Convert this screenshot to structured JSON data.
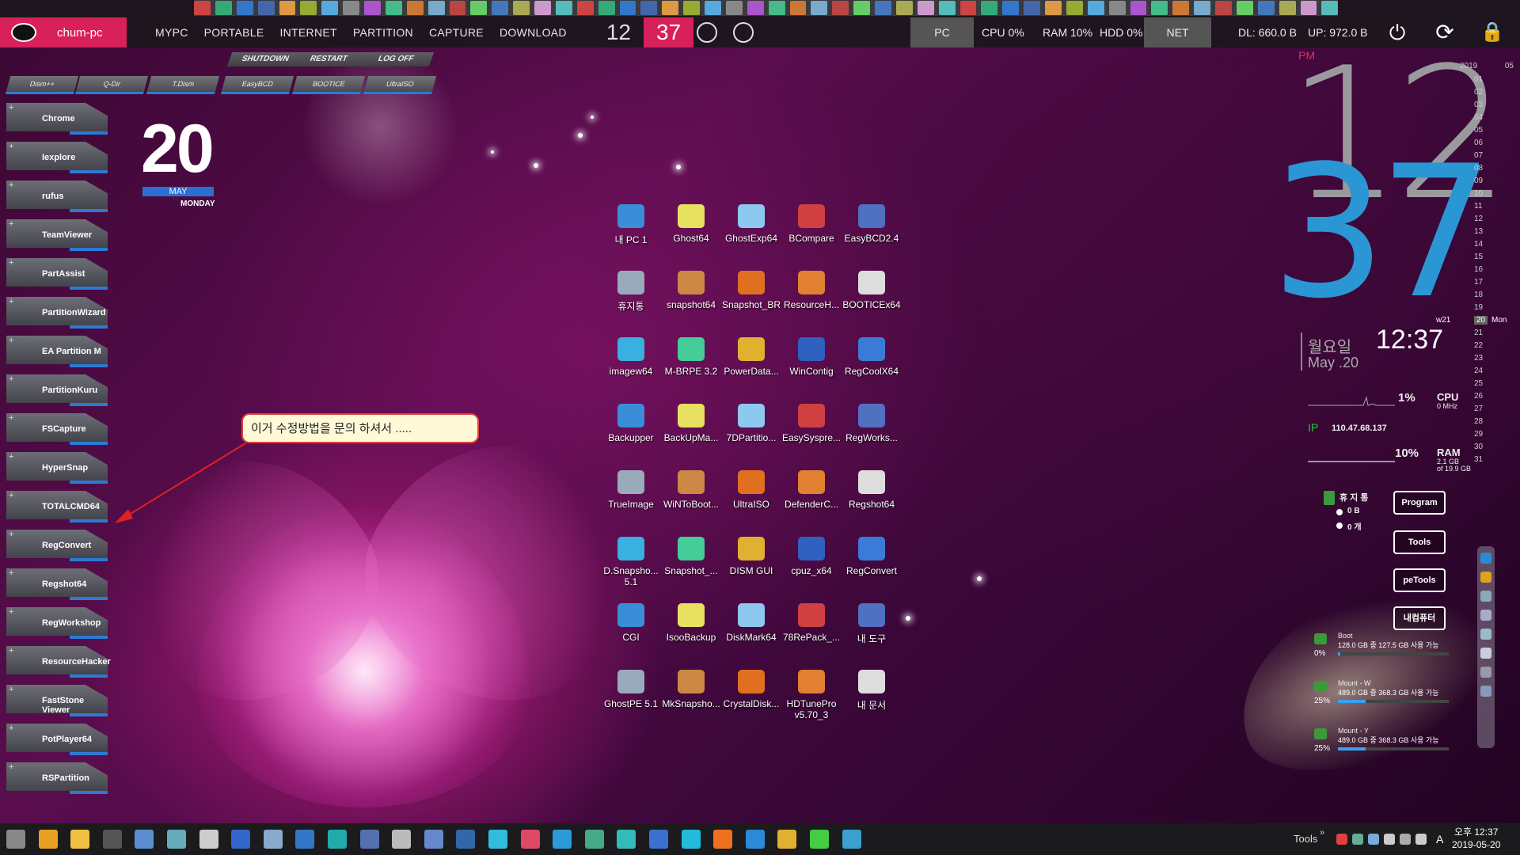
{
  "topbar": {
    "user": "chum-pc",
    "menu": [
      "MYPC",
      "PORTABLE",
      "INTERNET",
      "PARTITION",
      "CAPTURE",
      "DOWNLOAD"
    ],
    "hour": "12",
    "minute": "37",
    "pc_label": "PC",
    "cpu": "CPU  0%",
    "ram": "RAM  10%",
    "hdd": "HDD  0%",
    "net_label": "NET",
    "dl": "DL: 660.0 B",
    "up": "UP: 972.0 B"
  },
  "power": [
    "SHUTDOWN",
    "RESTART",
    "LOG  OFF"
  ],
  "quick_tools": [
    "Dism++",
    "Q-Dir",
    "T.Dism",
    "EasyBCD",
    "BOOTICE",
    "UltraISO"
  ],
  "launchers": [
    "Chrome",
    "Iexplore",
    "rufus",
    "TeamViewer",
    "PartAssist",
    "PartitionWizard",
    "EA  Partition  M",
    "PartitionKuru",
    "FSCapture",
    "HyperSnap",
    "TOTALCMD64",
    "RegConvert",
    "Regshot64",
    "RegWorkshop",
    "ResourceHacker",
    "FastStone  Viewer",
    "PotPlayer64",
    "RSPartition"
  ],
  "date": {
    "day": "20",
    "month": "MAY",
    "weekday": "MONDAY"
  },
  "callout": "이거 수정방법을 문의 하셔서 .....",
  "desktop_icons": [
    [
      "내 PC 1",
      "Ghost64",
      "GhostExp64",
      "BCompare",
      "EasyBCD2.4"
    ],
    [
      "휴지통",
      "snapshot64",
      "Snapshot_BR",
      "ResourceH...",
      "BOOTICEx64"
    ],
    [
      "imagew64",
      "M-BRPE 3.2",
      "PowerData...",
      "WinContig",
      "RegCoolX64"
    ],
    [
      "Backupper",
      "BackUpMa...",
      "7DPartitio...",
      "EasySyspre...",
      "RegWorks..."
    ],
    [
      "TrueImage",
      "WiNToBoot...",
      "UltraISO",
      "DefenderC...",
      "Regshot64"
    ],
    [
      "D.Snapsho... 5.1",
      "Snapshot_...",
      "DISM GUI",
      "cpuz_x64",
      "RegConvert"
    ],
    [
      "CGI",
      "IsooBackup",
      "DiskMark64",
      "78RePack_...",
      "내 도구"
    ],
    [
      "GhostPE 5.1",
      "MkSnapsho...",
      "CrystalDisk...",
      "HDTunePro v5.70_3",
      "내 문서"
    ]
  ],
  "clock": {
    "ampm": "PM",
    "hour": "12",
    "minute": "37",
    "time": "12:37",
    "day_kr": "월요일",
    "day_en": "May .20"
  },
  "meters": {
    "cpu_pct": "1%",
    "cpu_label": "CPU",
    "cpu_mhz": "0 MHz",
    "ip_label": "IP",
    "ip": "110.47.68.137",
    "ram_pct": "10%",
    "ram_label": "RAM",
    "ram_detail": "2.1 GB",
    "ram_total": "of 19.9 GB"
  },
  "calendar": {
    "year": "2019",
    "month": "05",
    "week": "w21",
    "today": "20",
    "today_name": "Mon",
    "days": [
      "01",
      "02",
      "03",
      "04",
      "05",
      "06",
      "07",
      "08",
      "09",
      "10",
      "11",
      "12",
      "13",
      "14",
      "15",
      "16",
      "17",
      "18",
      "19",
      "20",
      "21",
      "22",
      "23",
      "24",
      "25",
      "26",
      "27",
      "28",
      "29",
      "30",
      "31"
    ]
  },
  "recycle": {
    "label": "휴 지 통",
    "size": "0 B",
    "count": "0 개"
  },
  "side_buttons": [
    "Program",
    "Tools",
    "peTools",
    "내컴퓨터"
  ],
  "drives": [
    {
      "name": "Boot",
      "detail": "128.0 GB 중 127.5 GB 사용 가능",
      "pct": "0%",
      "fill": 0.01
    },
    {
      "name": "Mount - W",
      "detail": "489.0 GB 중 368.3 GB 사용 가능",
      "pct": "25%",
      "fill": 0.25
    },
    {
      "name": "Mount - Y",
      "detail": "489.0 GB 중 368.3 GB 사용 가능",
      "pct": "25%",
      "fill": 0.25
    }
  ],
  "taskbar": {
    "tools": "Tools",
    "tray_time": "오후 12:37",
    "tray_date": "2019-05-20",
    "ime": "A"
  }
}
